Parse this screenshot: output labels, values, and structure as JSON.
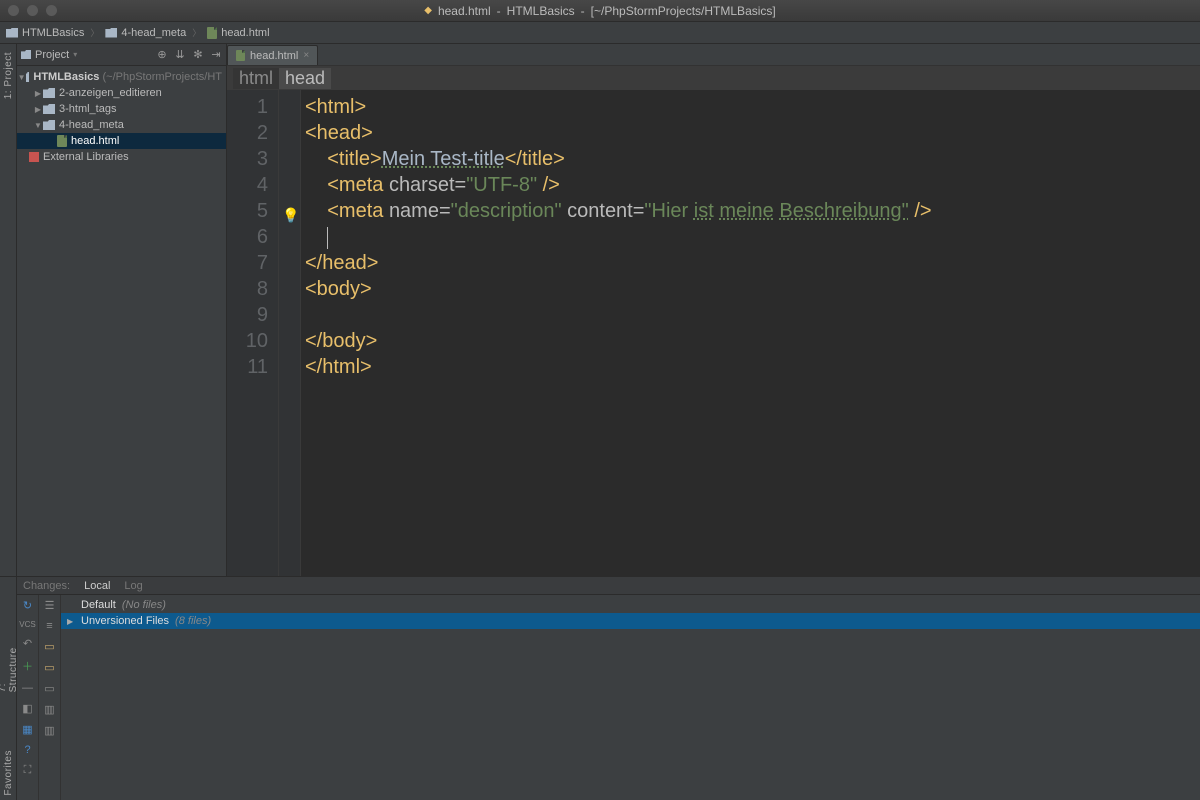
{
  "titlebar": {
    "filename": "head.html",
    "project": "HTMLBasics",
    "path": "[~/PhpStormProjects/HTMLBasics]"
  },
  "breadcrumb": {
    "items": [
      "HTMLBasics",
      "4-head_meta",
      "head.html"
    ]
  },
  "project_toolbar": {
    "label": "Project"
  },
  "tree": {
    "root": "HTMLBasics",
    "root_hint": "(~/PhpStormProjects/HT",
    "children": [
      "2-anzeigen_editieren",
      "3-html_tags",
      "4-head_meta"
    ],
    "file": "head.html",
    "external": "External Libraries"
  },
  "tabs": {
    "active": "head.html"
  },
  "crumb_strip": {
    "items": [
      "html",
      "head"
    ]
  },
  "code": {
    "lines": 11,
    "l1": {
      "open": "<html>"
    },
    "l2": {
      "open": "<head>"
    },
    "l3": {
      "open": "<title>",
      "text": "Mein Test-title",
      "close": "</title>"
    },
    "l4": {
      "open": "<meta ",
      "attr1": "charset=",
      "val1": "\"UTF-8\"",
      "close": " />"
    },
    "l5": {
      "open": "<meta ",
      "attr1": "name=",
      "val1": "\"description\"",
      "attr2": " content=",
      "val2a": "\"Hier",
      "sp1": " ",
      "val2b": "ist",
      "sp2": " ",
      "val2c": "meine",
      "sp3": " ",
      "val2d": "Beschreibung\"",
      "close": " />"
    },
    "l7": {
      "text": "</head>"
    },
    "l8": {
      "text": "<body>"
    },
    "l10": {
      "text": "</body>"
    },
    "l11": {
      "text": "</html>"
    }
  },
  "vcs": {
    "tabs": {
      "a": "Changes:",
      "b": "Local",
      "c": "Log"
    },
    "default_label": "Default",
    "default_hint": "(No files)",
    "unversioned_label": "Unversioned Files",
    "unversioned_hint": "(8 files)"
  },
  "sidestrips": {
    "project": "1: Project",
    "structure": "7: Structure",
    "favorites": "Favorites",
    "vcs": "VCS"
  }
}
